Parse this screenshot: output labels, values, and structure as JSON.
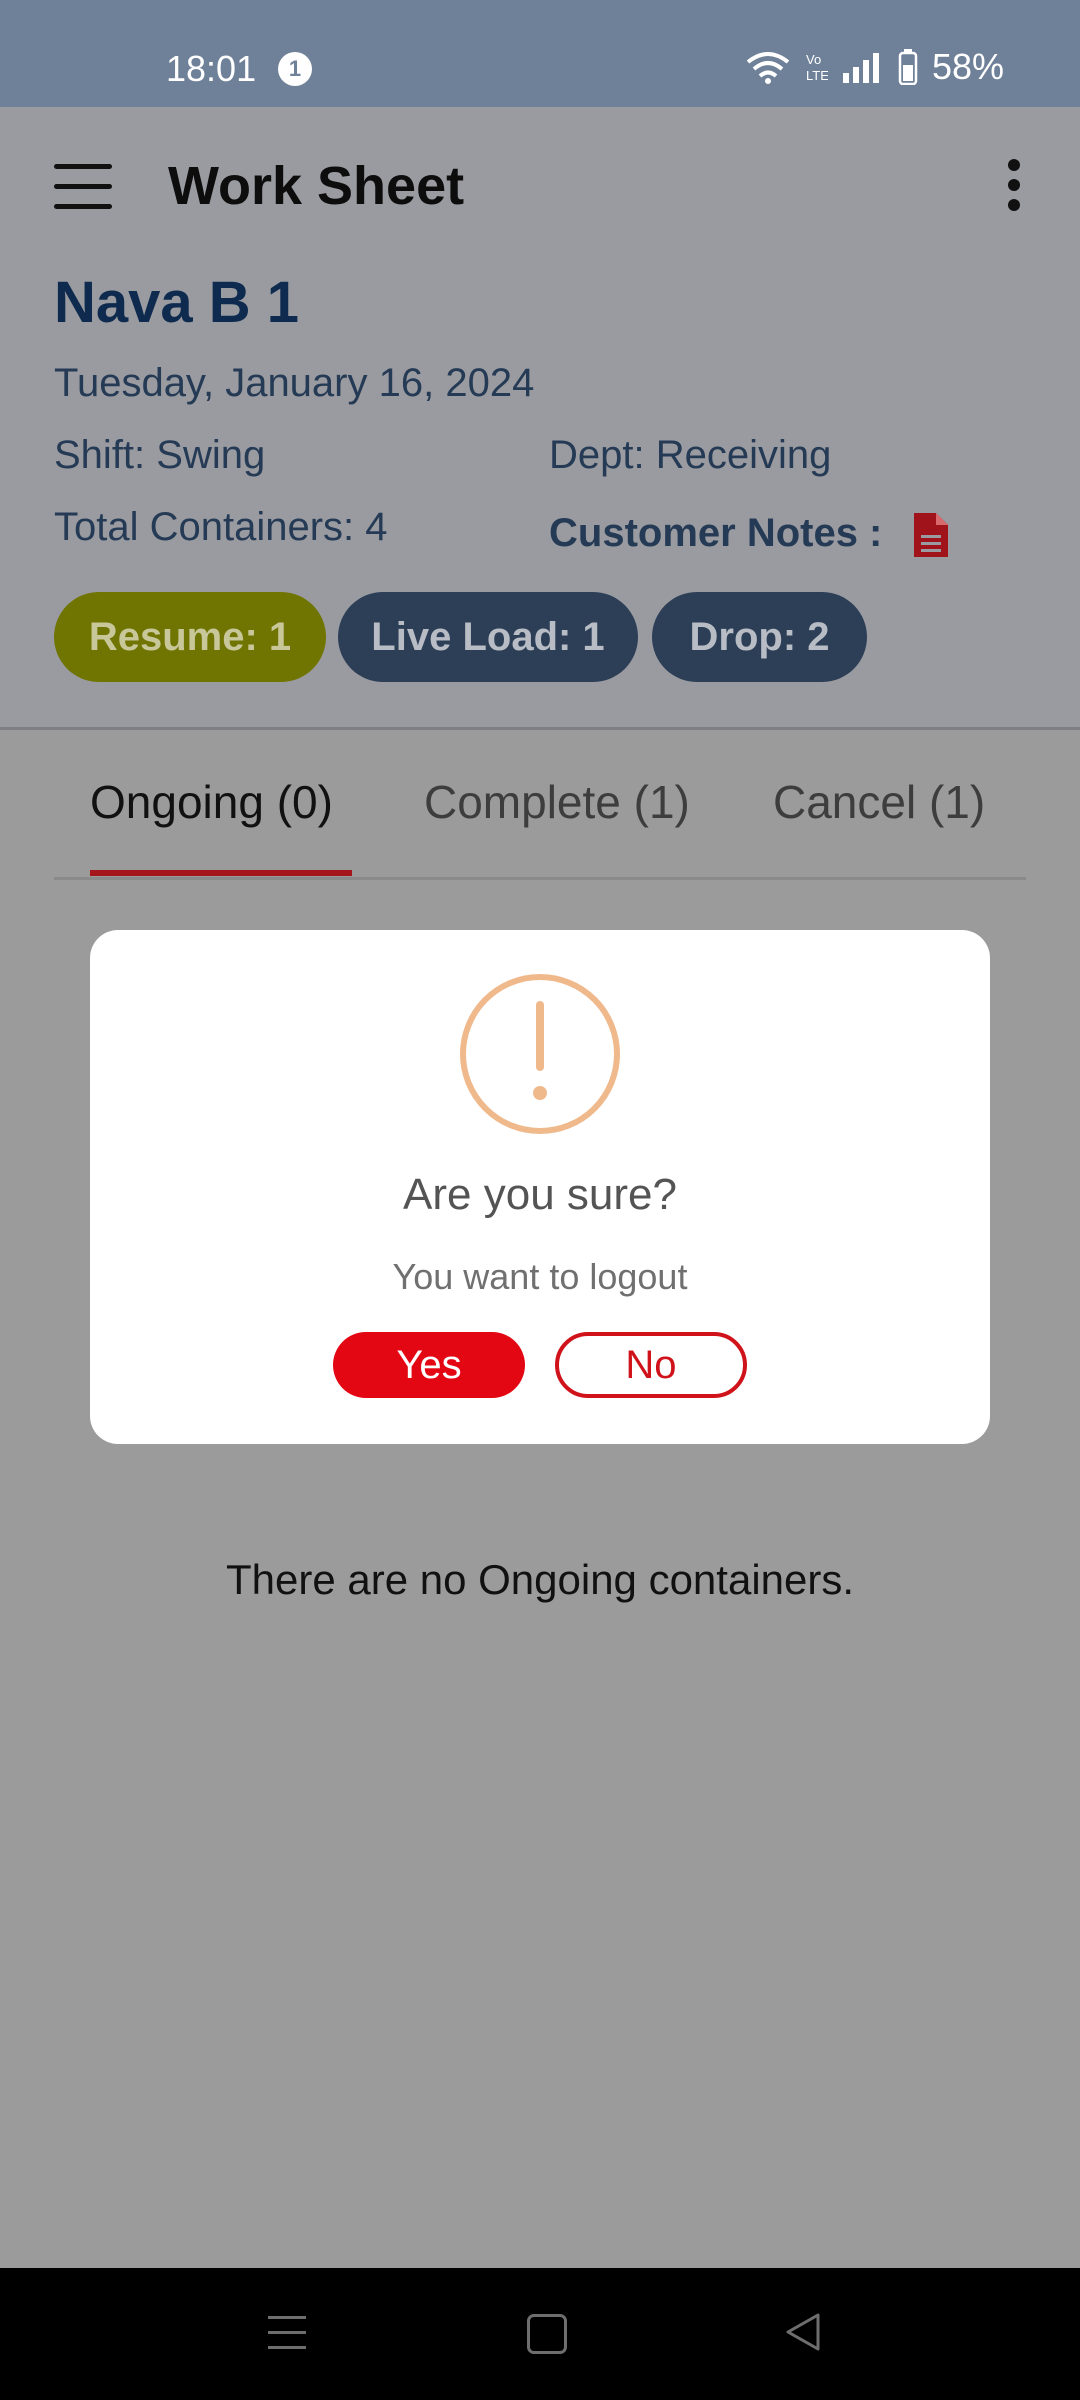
{
  "status_bar": {
    "time": "18:01",
    "notification_count": "1",
    "battery": "58%"
  },
  "app_bar": {
    "title": "Work Sheet"
  },
  "site": {
    "name": "Nava B 1",
    "date": "Tuesday, January 16, 2024",
    "shift": "Shift: Swing",
    "dept": "Dept: Receiving",
    "total_containers": "Total Containers: 4",
    "customer_notes": "Customer Notes :"
  },
  "pills": {
    "resume": "Resume: 1",
    "live_load": "Live Load: 1",
    "drop": "Drop: 2"
  },
  "tabs": {
    "ongoing": "Ongoing (0)",
    "complete": "Complete (1)",
    "cancel": "Cancel (1)"
  },
  "empty_message": "There are no Ongoing containers.",
  "dialog": {
    "title": "Are you sure?",
    "text": "You want to logout",
    "yes": "Yes",
    "no": "No"
  },
  "colors": {
    "accent": "#e30613",
    "navy": "#0e2b4f",
    "resume_pill": "#707400",
    "alert_icon": "#f0b98c"
  },
  "icons": [
    "menu-icon",
    "more-vertical-icon",
    "document-icon",
    "alert-circle-icon",
    "wifi-icon",
    "volte-icon",
    "signal-icon",
    "battery-icon"
  ]
}
